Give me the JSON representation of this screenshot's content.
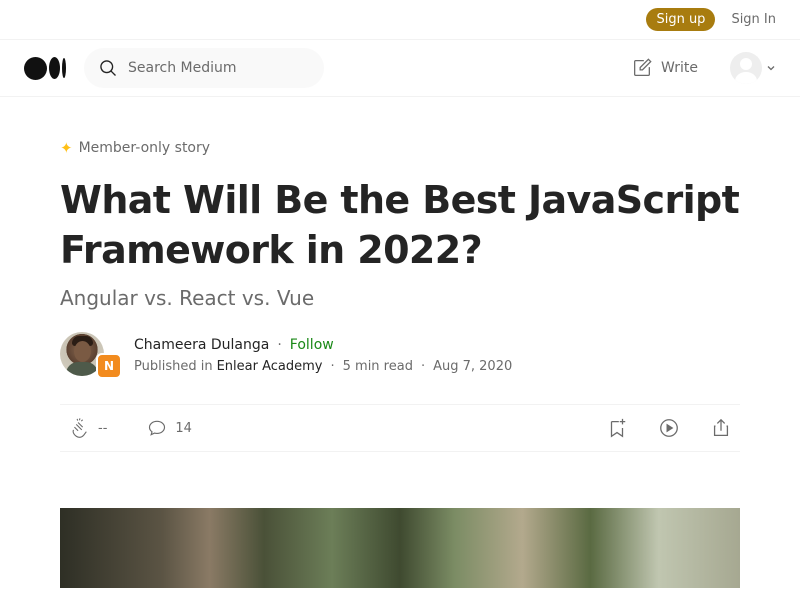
{
  "topbar": {
    "signup_label": "Sign up",
    "signin_label": "Sign In"
  },
  "header": {
    "logo": "medium-logo-icon",
    "search_placeholder": "Search Medium",
    "write_label": "Write"
  },
  "article": {
    "member_label": "Member-only story",
    "title": "What Will Be the Best JavaScript Framework in 2022?",
    "subtitle": "Angular vs. React vs. Vue",
    "author": {
      "name": "Chameera Dulanga",
      "follow_label": "Follow",
      "published_prefix": "Published in",
      "publication": "Enlear Academy",
      "read_time": "5 min read",
      "date": "Aug 7, 2020"
    },
    "actions": {
      "claps": "--",
      "responses": "14"
    }
  },
  "colors": {
    "signup_bg": "#a87c0f",
    "follow": "#1a8917",
    "member_star": "#ffc017"
  }
}
